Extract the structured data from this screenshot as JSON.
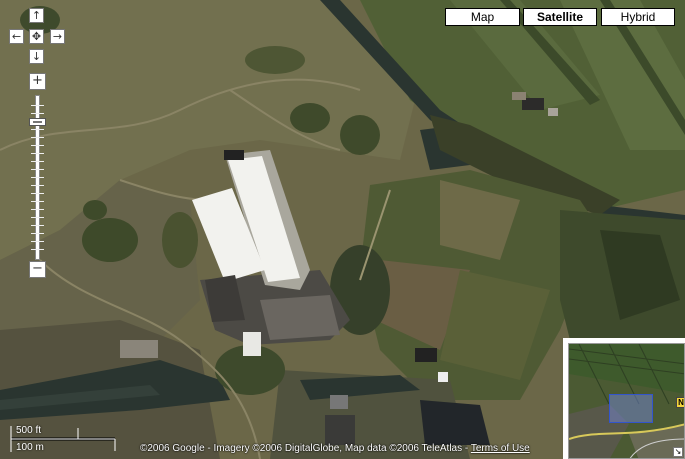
{
  "pan": {
    "up": "↑",
    "left": "←",
    "center": "✥",
    "right": "→",
    "down": "↓"
  },
  "zoom": {
    "plus": "+",
    "minus": "−"
  },
  "map_types": {
    "map": "Map",
    "satellite": "Satellite",
    "hybrid": "Hybrid",
    "active": "satellite"
  },
  "scale": {
    "feet": "500 ft",
    "meters": "100 m"
  },
  "copyright": {
    "text": "©2006 Google - Imagery ©2006 DigitalGlobe, Map data ©2006 TeleAtlas - ",
    "terms": "Terms of Use"
  },
  "overview": {
    "road_label": "N",
    "toggle": "↘"
  },
  "colors": {
    "terrain": "#6b6748",
    "field": "#4f5a34",
    "water": "#2a3530",
    "roof": "#f2f2ee"
  }
}
